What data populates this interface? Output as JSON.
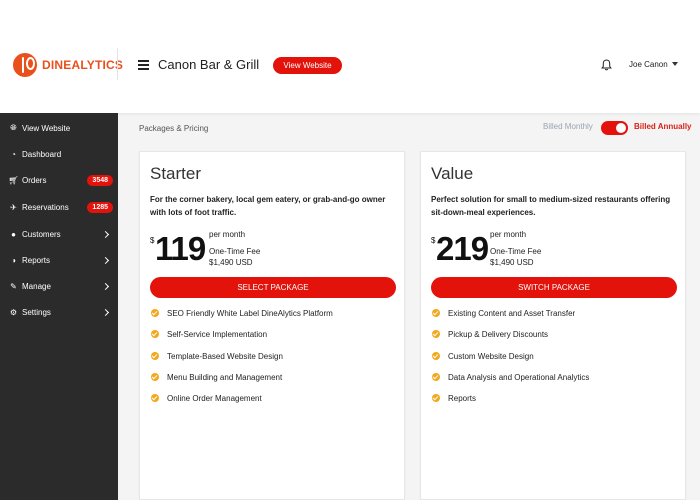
{
  "header": {
    "logo_text": "DINEALYTICS",
    "restaurant_name": "Canon Bar & Grill",
    "view_website_label": "View Website",
    "user_name": "Joe Canon"
  },
  "sidebar": {
    "items": [
      {
        "label": "View Website",
        "icon": "globe-icon"
      },
      {
        "label": "Dashboard",
        "icon": "dashboard-icon"
      },
      {
        "label": "Orders",
        "icon": "cart-icon",
        "badge": "3548"
      },
      {
        "label": "Reservations",
        "icon": "reservation-icon",
        "badge": "1285"
      },
      {
        "label": "Customers",
        "icon": "users-icon"
      },
      {
        "label": "Reports",
        "icon": "chart-icon"
      },
      {
        "label": "Manage",
        "icon": "edit-icon"
      },
      {
        "label": "Settings",
        "icon": "gear-icon"
      }
    ]
  },
  "main": {
    "breadcrumb": "Packages & Pricing",
    "billed_monthly": "Billed Monthly",
    "billed_annually": "Billed Annually",
    "billing_annual_selected": true
  },
  "cards": [
    {
      "title": "Starter",
      "description": "For the corner bakery, local gem eatery, or grab-and-go owner with lots of foot traffic.",
      "currency": "$",
      "price": "119",
      "period": "per month",
      "fee_label": "One-Time Fee",
      "fee_amount": "$1,490 USD",
      "button_label": "SELECT PACKAGE",
      "features": [
        "SEO Friendly White Label DineAlytics Platform",
        "Self-Service Implementation",
        "Template-Based Website Design",
        "Menu Building and Management",
        "Online Order Management"
      ]
    },
    {
      "title": "Value",
      "description": "Perfect solution for small to medium-sized restaurants offering sit-down-meal experiences.",
      "currency": "$",
      "price": "219",
      "period": "per month",
      "fee_label": "One-Time Fee",
      "fee_amount": "$1,490 USD",
      "button_label": "SWITCH PACKAGE",
      "features": [
        "Existing Content and Asset Transfer",
        "Pickup & Delivery Discounts",
        "Custom Website Design",
        "Data Analysis and Operational Analytics",
        "Reports"
      ]
    }
  ],
  "colors": {
    "accent": "#e3120b",
    "brand": "#e8501c",
    "sidebar_bg": "#2b2b2b",
    "check": "#f4a81a"
  }
}
